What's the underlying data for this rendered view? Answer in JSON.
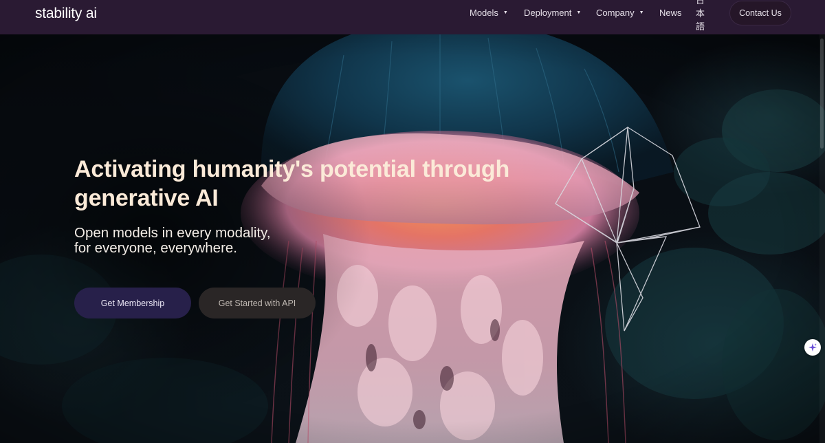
{
  "nav": {
    "logo": "stability ai",
    "items": [
      {
        "label": "Models",
        "has_dropdown": true
      },
      {
        "label": "Deployment",
        "has_dropdown": true
      },
      {
        "label": "Company",
        "has_dropdown": true
      },
      {
        "label": "News",
        "has_dropdown": false
      },
      {
        "label": "日本語",
        "has_dropdown": false
      }
    ],
    "caret": "▼",
    "contact": "Contact Us"
  },
  "hero": {
    "headline": "Activating humanity's potential through generative AI",
    "subtitle_line1": "Open models in every modality,",
    "subtitle_line2": "for everyone, everywhere.",
    "primary_button": "Get Membership",
    "secondary_button": "Get Started with API"
  },
  "widgets": {
    "assistant_icon": "sparkle-icon"
  },
  "colors": {
    "nav_bg": "#2a1a33",
    "headline": "#fbead8",
    "primary_button": "#27204a",
    "secondary_button": "#2a2626"
  }
}
